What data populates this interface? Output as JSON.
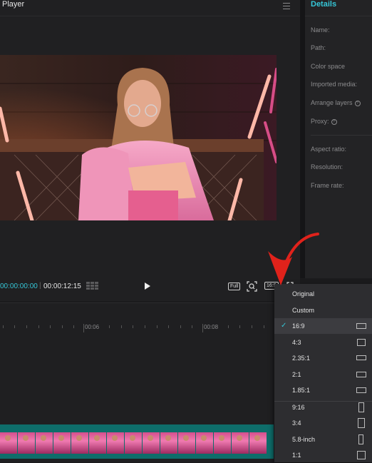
{
  "player": {
    "title": "Player",
    "menu_icon": "hamburger-icon",
    "current_time": "00:00:00:00",
    "total_time": "00:00:12:15",
    "full_label": "Full",
    "ratio_label": "16:9"
  },
  "details": {
    "title": "Details",
    "fields": [
      {
        "label": "Name:"
      },
      {
        "label": "Path:"
      },
      {
        "label": "Color space"
      },
      {
        "label": "Imported media:"
      },
      {
        "label": "Arrange layers"
      },
      {
        "label": "Proxy:"
      },
      {
        "label": "Aspect ratio:"
      },
      {
        "label": "Resolution:"
      },
      {
        "label": "Frame rate:"
      }
    ]
  },
  "timeline": {
    "marks": [
      "00:06",
      "00:08"
    ]
  },
  "ratio_menu": {
    "selected": "16:9",
    "items": [
      {
        "label": "Original"
      },
      {
        "label": "Custom"
      },
      {
        "label": "16:9",
        "icon": "landscape-ratio-icon"
      },
      {
        "label": "4:3",
        "icon": "landscape-ratio-icon"
      },
      {
        "label": "2.35:1",
        "icon": "landscape-ratio-icon"
      },
      {
        "label": "2:1",
        "icon": "landscape-ratio-icon"
      },
      {
        "label": "1.85:1",
        "icon": "landscape-ratio-icon"
      },
      {
        "label": "9:16",
        "icon": "portrait-ratio-icon"
      },
      {
        "label": "3:4",
        "icon": "portrait-ratio-icon"
      },
      {
        "label": "5.8-inch",
        "icon": "portrait-ratio-icon"
      },
      {
        "label": "1:1",
        "icon": "square-ratio-icon"
      }
    ]
  },
  "colors": {
    "accent": "#35c7d8",
    "annotation_arrow": "#e0221b",
    "track": "#0e6d6a"
  }
}
